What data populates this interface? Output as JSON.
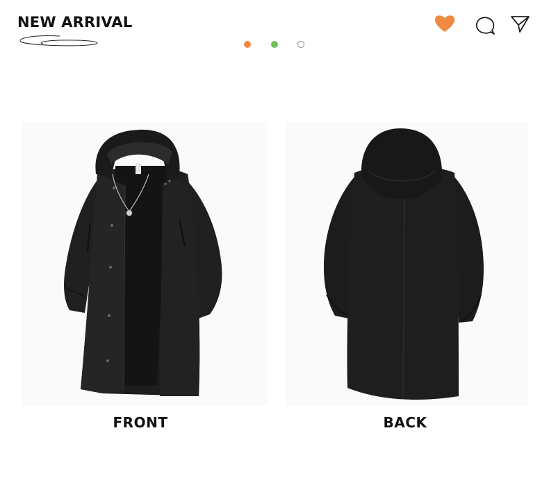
{
  "header": {
    "title": "NEW ARRIVAL"
  },
  "colors": {
    "accent_orange": "#f08a42",
    "accent_green": "#72c05a",
    "garment": "#1c1c1c"
  },
  "carousel": {
    "dots": [
      "orange",
      "green",
      "outline"
    ]
  },
  "icons": {
    "like": "heart-icon",
    "comment": "speech-bubble-icon",
    "share": "paper-plane-icon"
  },
  "views": {
    "front_label": "FRONT",
    "back_label": "BACK"
  }
}
